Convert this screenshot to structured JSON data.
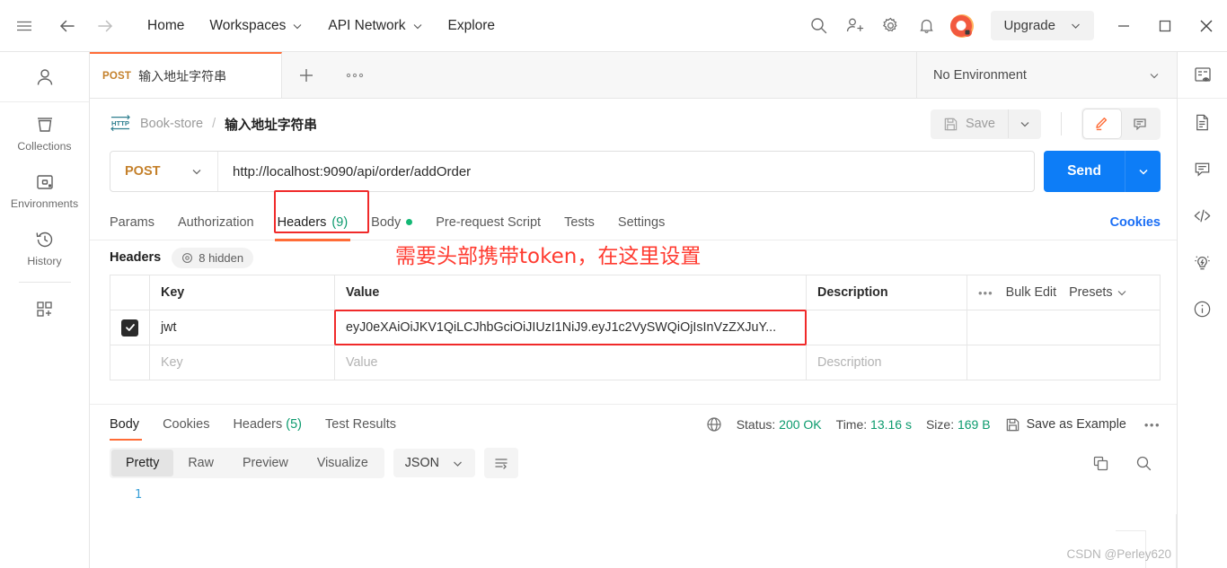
{
  "header": {
    "nav": [
      {
        "label": "Home",
        "caret": false
      },
      {
        "label": "Workspaces",
        "caret": true
      },
      {
        "label": "API Network",
        "caret": true
      },
      {
        "label": "Explore",
        "caret": false
      }
    ],
    "upgrade_label": "Upgrade",
    "icons": [
      "search-icon",
      "invite-user-icon",
      "settings-gear-icon",
      "notification-bell-icon",
      "postman-avatar-icon"
    ],
    "window_controls": [
      "minimize",
      "maximize",
      "close"
    ]
  },
  "left_rail": {
    "items": [
      {
        "label": "Collections",
        "icon": "collections-icon"
      },
      {
        "label": "Environments",
        "icon": "environments-icon"
      },
      {
        "label": "History",
        "icon": "history-icon"
      }
    ],
    "new_label": "new-apps-icon"
  },
  "right_rail": {
    "icons": [
      "environment-quick-look-icon",
      "documentation-icon",
      "comments-icon",
      "code-snippet-icon",
      "info-bulb-icon",
      "info-circle-icon"
    ]
  },
  "tabstrip": {
    "tab": {
      "method": "POST",
      "name": "输入地址字符串"
    },
    "new_tab_label": "+",
    "more_label": "•••",
    "environment": {
      "value": "No Environment"
    }
  },
  "breadcrumb": {
    "protocol_icon": "http-icon",
    "collection": "Book-store",
    "separator": "/",
    "request": "输入地址字符串",
    "save_label": "Save",
    "edit_icon": "pencil-icon",
    "comment_icon": "comment-icon"
  },
  "url_bar": {
    "method": "POST",
    "url": "http://localhost:9090/api/order/addOrder",
    "send_label": "Send"
  },
  "request_tabs": {
    "items": [
      {
        "label": "Params",
        "count": "",
        "dot": false,
        "active": false
      },
      {
        "label": "Authorization",
        "count": "",
        "dot": false,
        "active": false
      },
      {
        "label": "Headers",
        "count": "(9)",
        "dot": false,
        "active": true
      },
      {
        "label": "Body",
        "count": "",
        "dot": true,
        "active": false
      },
      {
        "label": "Pre-request Script",
        "count": "",
        "dot": false,
        "active": false
      },
      {
        "label": "Tests",
        "count": "",
        "dot": false,
        "active": false
      },
      {
        "label": "Settings",
        "count": "",
        "dot": false,
        "active": false
      }
    ],
    "cookies_label": "Cookies"
  },
  "headers_section": {
    "title": "Headers",
    "hidden_label": "8 hidden",
    "annotation": "需要头部携带token，在这里设置",
    "columns": [
      "Key",
      "Value",
      "Description"
    ],
    "actions": {
      "dots": "•••",
      "bulk_edit": "Bulk Edit",
      "presets": "Presets"
    },
    "rows": [
      {
        "checked": true,
        "key": "jwt",
        "value": "eyJ0eXAiOiJKV1QiLCJhbGciOiJIUzI1NiJ9.eyJ1c2VySWQiOjIsInVzZXJuY...",
        "description": "",
        "highlighted": true
      }
    ],
    "placeholder_row": {
      "key": "Key",
      "value": "Value",
      "description": "Description"
    }
  },
  "response": {
    "tabs": [
      {
        "label": "Body",
        "count": "",
        "active": true
      },
      {
        "label": "Cookies",
        "count": "",
        "active": false
      },
      {
        "label": "Headers",
        "count": "(5)",
        "active": false
      },
      {
        "label": "Test Results",
        "count": "",
        "active": false
      }
    ],
    "meta": {
      "status_label": "Status:",
      "status_value": "200 OK",
      "time_label": "Time:",
      "time_value": "13.16 s",
      "size_label": "Size:",
      "size_value": "169 B"
    },
    "save_as_example": "Save as Example",
    "more": "•••",
    "view_modes": [
      "Pretty",
      "Raw",
      "Preview",
      "Visualize"
    ],
    "active_view": "Pretty",
    "format": "JSON",
    "wrap_icon": "word-wrap-icon",
    "copy_icon": "copy-icon",
    "search_icon": "search-icon",
    "line_numbers": [
      "1"
    ]
  },
  "watermark": "CSDN @Perley620",
  "colors": {
    "accent_orange": "#ff6c37",
    "send_blue": "#0d7df7",
    "annotation_red": "#ff3b30",
    "highlight_red": "#f02a2a",
    "status_green": "#0b9a6d",
    "method_orange": "#c4802a",
    "link_blue": "#1a6ef5"
  }
}
